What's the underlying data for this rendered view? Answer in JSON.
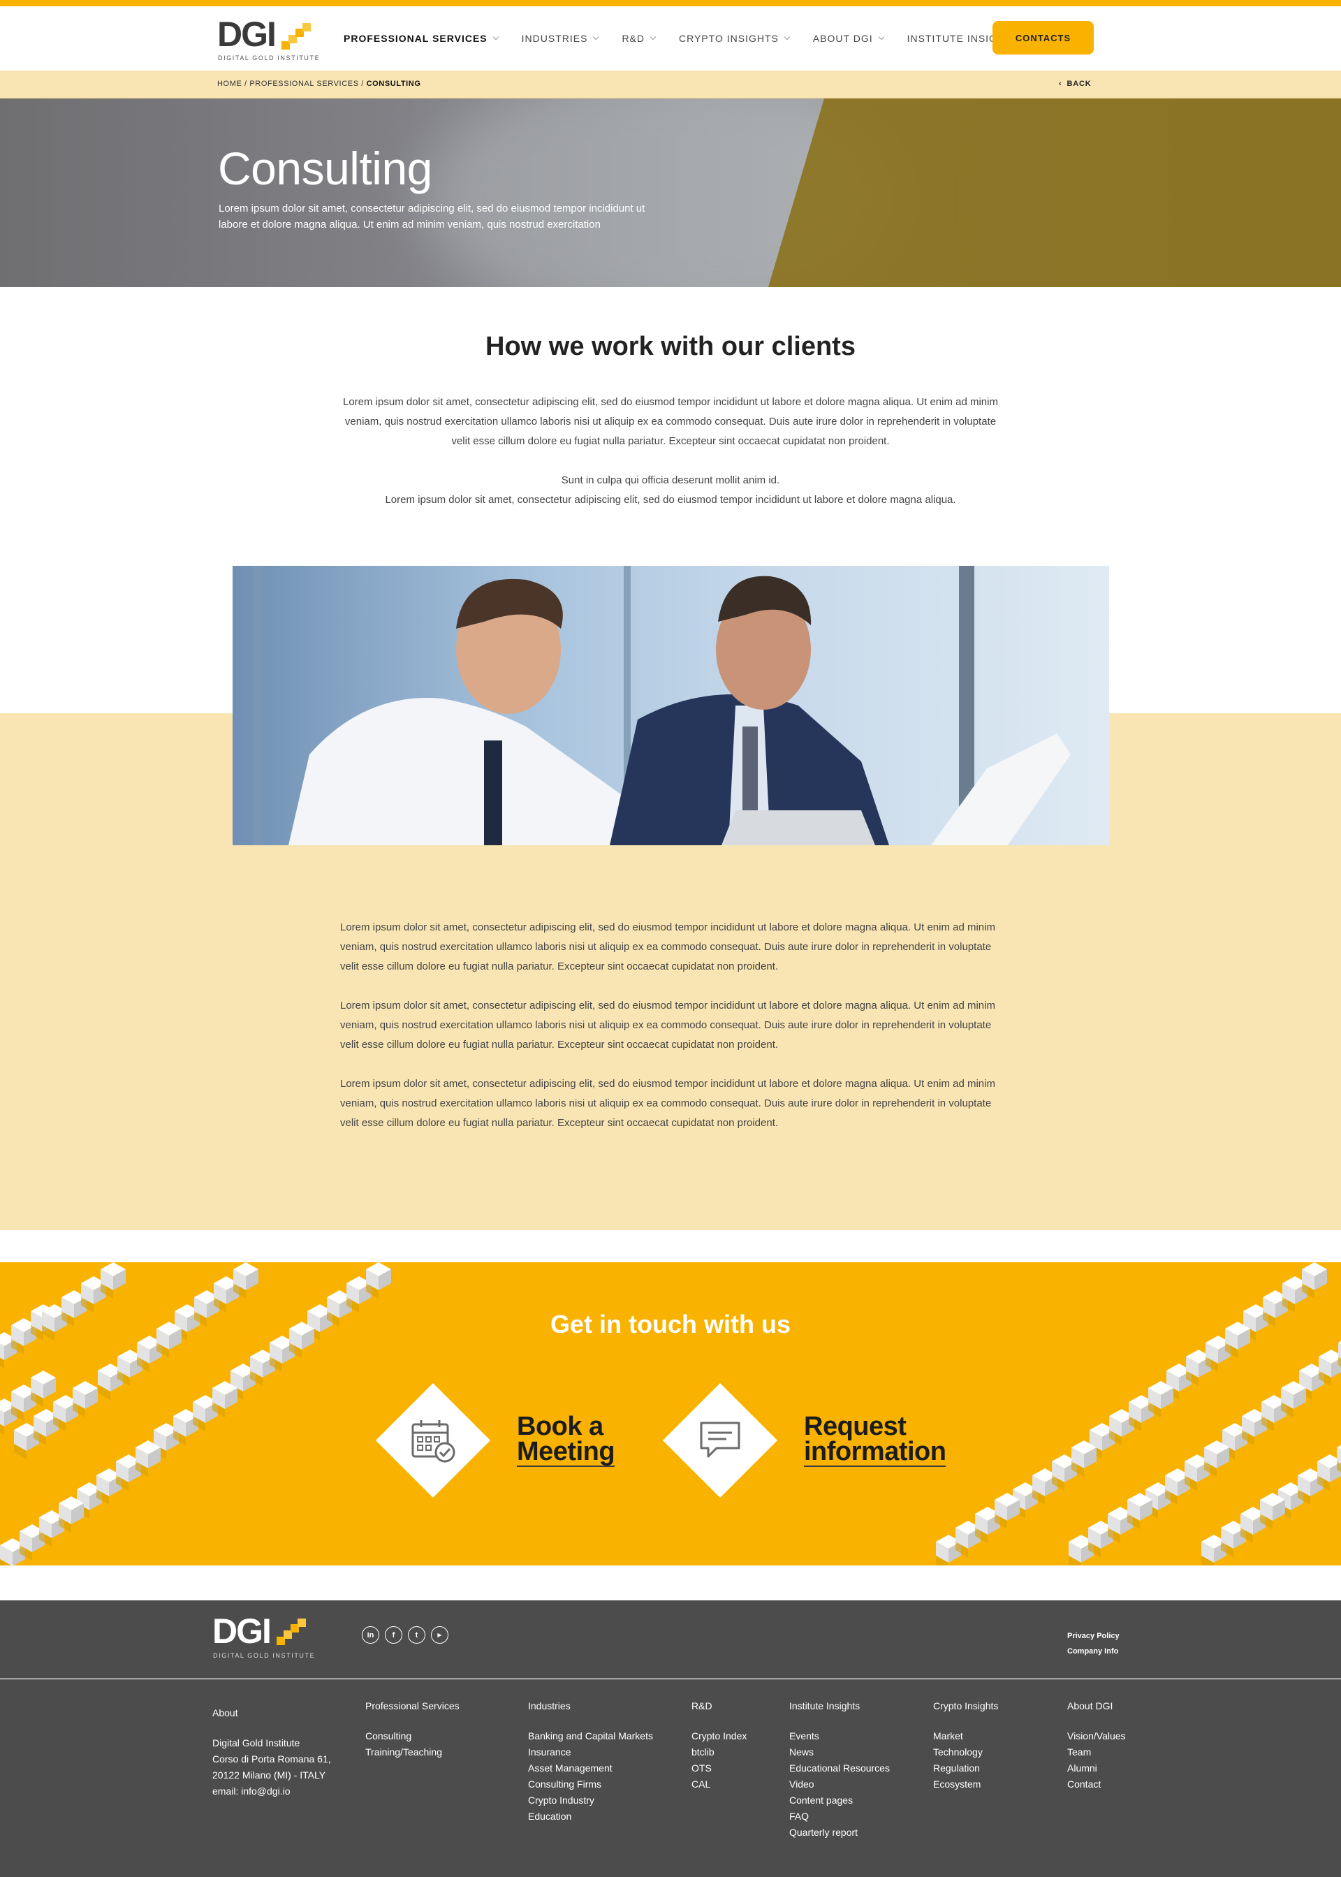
{
  "brand": {
    "logo_text": "DGI",
    "logo_subtitle": "DIGITAL GOLD INSTITUTE",
    "accent_color": "#f9b200",
    "light_accent": "#f9e5b3",
    "footer_bg": "#4c4c4c"
  },
  "nav": {
    "items": [
      {
        "label": "PROFESSIONAL SERVICES",
        "has_dropdown": true,
        "active": true
      },
      {
        "label": "INDUSTRIES",
        "has_dropdown": true
      },
      {
        "label": "R&D",
        "has_dropdown": true
      },
      {
        "label": "CRYPTO INSIGHTS",
        "has_dropdown": true
      },
      {
        "label": "ABOUT DGI",
        "has_dropdown": true
      },
      {
        "label": "INSTITUTE INSIGHTS",
        "has_dropdown": false
      }
    ],
    "contacts_label": "CONTACTS"
  },
  "breadcrumb": {
    "home": "HOME",
    "parent": "PROFESSIONAL SERVICES",
    "current": "CONSULTING",
    "separator": " / ",
    "back_label": "BACK"
  },
  "hero": {
    "title": "Consulting",
    "text": "Lorem ipsum dolor sit amet, consectetur adipiscing elit, sed do eiusmod tempor incididunt ut labore et dolore magna aliqua. Ut enim ad minim veniam, quis nostrud exercitation"
  },
  "intro": {
    "title": "How we work with our clients",
    "paragraph1": "Lorem ipsum dolor sit amet, consectetur adipiscing elit, sed do eiusmod tempor incididunt ut labore et dolore magna aliqua. Ut enim ad minim veniam, quis nostrud exercitation ullamco laboris nisi ut aliquip ex ea commodo consequat. Duis aute irure dolor in reprehenderit in voluptate velit esse cillum dolore eu fugiat nulla pariatur. Excepteur sint occaecat cupidatat non proident.",
    "paragraph2_line1": "Sunt in culpa qui officia deserunt mollit anim id.",
    "paragraph2_line2": "Lorem ipsum dolor sit amet, consectetur adipiscing elit, sed do eiusmod tempor incididunt ut labore et dolore magna aliqua."
  },
  "body": {
    "paragraphs": [
      "Lorem ipsum dolor sit amet, consectetur adipiscing elit, sed do eiusmod tempor incididunt ut labore et dolore magna aliqua. Ut enim ad minim veniam, quis nostrud exercitation ullamco laboris nisi ut aliquip ex ea commodo consequat. Duis aute irure dolor in reprehenderit in voluptate velit esse cillum dolore eu fugiat nulla pariatur. Excepteur sint occaecat cupidatat non proident.",
      "Lorem ipsum dolor sit amet, consectetur adipiscing elit, sed do eiusmod tempor incididunt ut labore et dolore magna aliqua. Ut enim ad minim veniam, quis nostrud exercitation ullamco laboris nisi ut aliquip ex ea commodo consequat. Duis aute irure dolor in reprehenderit in voluptate velit esse cillum dolore eu fugiat nulla pariatur. Excepteur sint occaecat cupidatat non proident.",
      "Lorem ipsum dolor sit amet, consectetur adipiscing elit, sed do eiusmod tempor incididunt ut labore et dolore magna aliqua. Ut enim ad minim veniam, quis nostrud exercitation ullamco laboris nisi ut aliquip ex ea commodo consequat. Duis aute irure dolor in reprehenderit in voluptate velit esse cillum dolore eu fugiat nulla pariatur. Excepteur sint occaecat cupidatat non proident."
    ]
  },
  "cta": {
    "title": "Get in touch with us",
    "book_line1": "Book a",
    "book_line2": "Meeting",
    "book_icon": "calendar-check-icon",
    "request_line1": "Request",
    "request_line2": "information",
    "request_icon": "chat-bubble-icon"
  },
  "footer": {
    "logo_text": "DGI",
    "logo_subtitle": "DIGITAL GOLD INSTITUTE",
    "social": [
      {
        "icon": "linkedin-icon",
        "glyph": "in"
      },
      {
        "icon": "facebook-icon",
        "glyph": "f"
      },
      {
        "icon": "twitter-icon",
        "glyph": "t"
      },
      {
        "icon": "youtube-icon",
        "glyph": "▶"
      }
    ],
    "privacy": "Privacy Policy",
    "company": "Company Info",
    "columns": [
      {
        "title": "About",
        "items": [
          "Digital Gold Institute",
          "Corso di Porta Romana 61,",
          "20122 Milano (MI) - ITALY",
          "email: info@dgi.io"
        ]
      },
      {
        "title": "Professional Services",
        "items": [
          "Consulting",
          "Training/Teaching"
        ]
      },
      {
        "title": "Industries",
        "items": [
          "Banking and Capital Markets",
          "Insurance",
          "Asset Management",
          "Consulting Firms",
          "Crypto Industry",
          "Education"
        ]
      },
      {
        "title": "R&D",
        "items": [
          "Crypto Index",
          "btclib",
          "OTS",
          "CAL"
        ]
      },
      {
        "title": "Institute Insights",
        "items": [
          "Events",
          "News",
          "Educational Resources",
          "Video",
          "Content pages",
          "FAQ",
          "Quarterly report"
        ]
      },
      {
        "title": "Crypto Insights",
        "items": [
          "Market",
          "Technology",
          "Regulation",
          "Ecosystem"
        ]
      },
      {
        "title": "About DGI",
        "items": [
          "Vision/Values",
          "Team",
          "Alumni",
          "Contact"
        ]
      }
    ]
  }
}
